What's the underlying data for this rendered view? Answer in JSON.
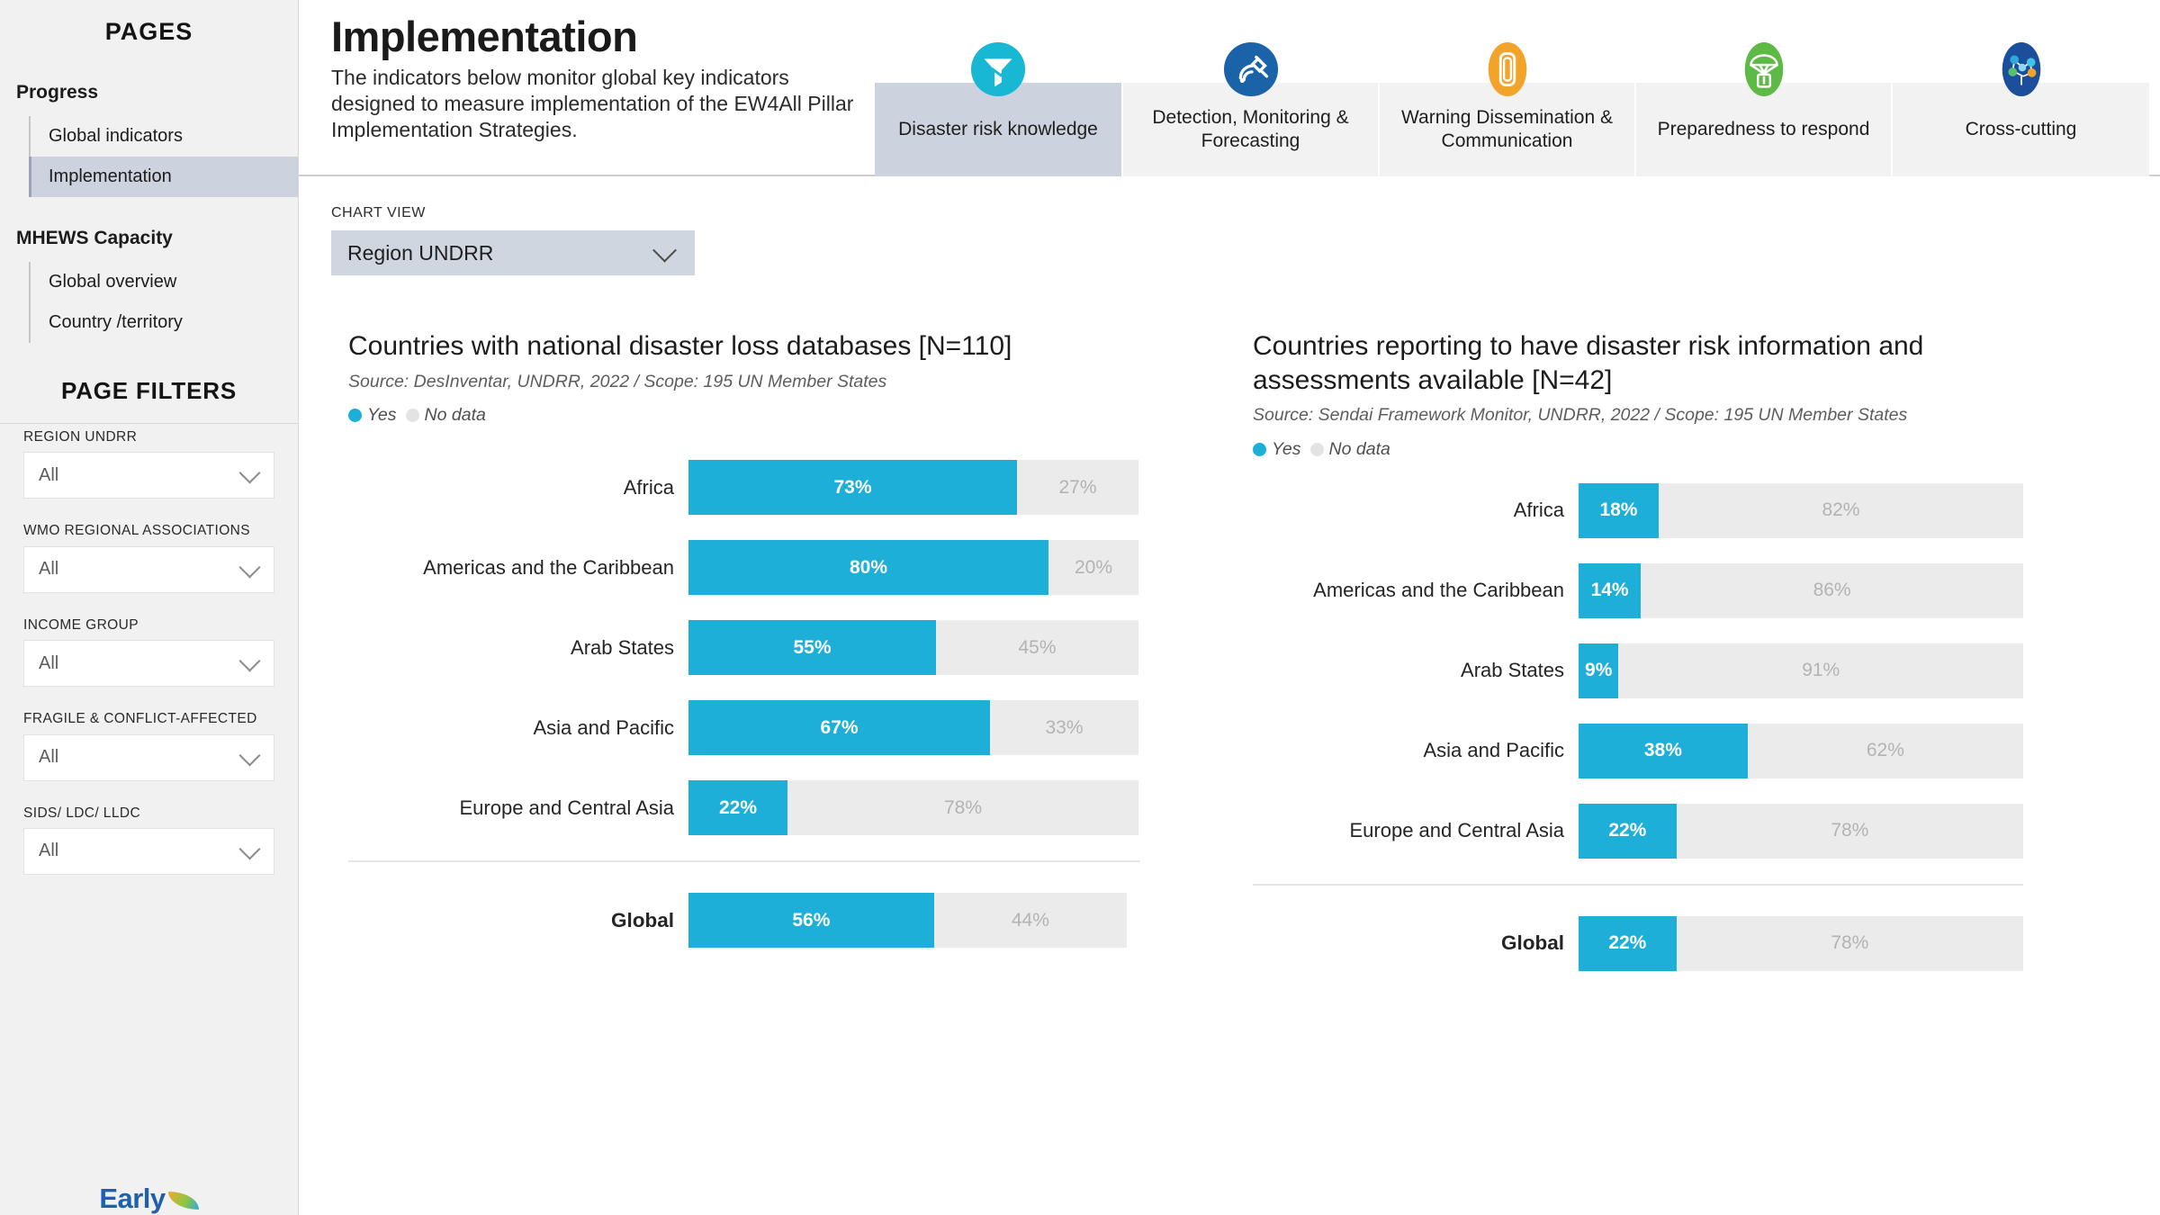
{
  "sidebar": {
    "pages_title": "PAGES",
    "groups": [
      {
        "title": "Progress",
        "items": [
          {
            "label": "Global indicators",
            "active": false
          },
          {
            "label": "Implementation",
            "active": true
          }
        ]
      },
      {
        "title": "MHEWS Capacity",
        "items": [
          {
            "label": "Global overview",
            "active": false
          },
          {
            "label": "Country /territory",
            "active": false
          }
        ]
      }
    ],
    "filters_title": "PAGE FILTERS",
    "filters": [
      {
        "label": "REGION UNDRR",
        "value": "All"
      },
      {
        "label": "WMO REGIONAL ASSOCIATIONS",
        "value": "All"
      },
      {
        "label": "INCOME GROUP",
        "value": "All"
      },
      {
        "label": "FRAGILE & CONFLICT-AFFECTED",
        "value": "All"
      },
      {
        "label": "SIDS/ LDC/ LLDC",
        "value": "All"
      }
    ],
    "logo_text": "Early"
  },
  "header": {
    "title": "Implementation",
    "description": "The indicators below monitor global key indicators designed to measure implementation of the EW4All Pillar Implementation Strategies."
  },
  "tabs": [
    {
      "label": "Disaster risk knowledge",
      "icon": "funnel-data-icon",
      "active": true,
      "color": "#18b7d4"
    },
    {
      "label": "Detection, Monitoring & Forecasting",
      "icon": "satellite-icon",
      "active": false,
      "color": "#1b63a8"
    },
    {
      "label": "Warning Dissemination & Communication",
      "icon": "megaphone-icon",
      "active": false,
      "color": "#f2a32a"
    },
    {
      "label": "Preparedness to respond",
      "icon": "parachute-icon",
      "active": false,
      "color": "#5eba46"
    },
    {
      "label": "Cross-cutting",
      "icon": "network-brain-icon",
      "active": false,
      "color": "#1b4f9c"
    }
  ],
  "chart_view": {
    "label": "CHART VIEW",
    "value": "Region UNDRR"
  },
  "colors": {
    "yes": "#1eafd8",
    "no_data": "#ebebeb",
    "active_tab": "#ccd3de",
    "sidebar_bg": "#f1f1f1"
  },
  "chart_data": [
    {
      "type": "bar",
      "orientation": "horizontal-stacked-100",
      "title": "Countries with national disaster loss databases [N=110]",
      "subtitle": "Source: DesInventar, UNDRR, 2022 / Scope: 195 UN Member States",
      "legend": [
        "Yes",
        "No data"
      ],
      "legend_position": "top-left",
      "xlabel": "",
      "ylabel": "",
      "xlim": [
        0,
        100
      ],
      "grid": false,
      "categories": [
        "Africa",
        "Americas and the Caribbean",
        "Arab States",
        "Asia and Pacific",
        "Europe and Central Asia"
      ],
      "series": [
        {
          "name": "Yes",
          "values": [
            73,
            80,
            55,
            67,
            22
          ]
        },
        {
          "name": "No data",
          "values": [
            27,
            20,
            45,
            33,
            78
          ]
        }
      ],
      "labels_yes": [
        "73%",
        "80%",
        "55%",
        "67%",
        "22%"
      ],
      "labels_nodata": [
        "27%",
        "20%",
        "45%",
        "33%",
        "78%"
      ],
      "total_row": {
        "label": "Global",
        "yes": 56,
        "no_data": 44,
        "label_yes": "56%",
        "label_nodata": "44%"
      }
    },
    {
      "type": "bar",
      "orientation": "horizontal-stacked-100",
      "title": "Countries reporting to have disaster risk information and assessments available [N=42]",
      "subtitle": "Source: Sendai Framework Monitor, UNDRR, 2022 / Scope: 195 UN Member States",
      "legend": [
        "Yes",
        "No data"
      ],
      "legend_position": "top-left",
      "xlabel": "",
      "ylabel": "",
      "xlim": [
        0,
        100
      ],
      "grid": false,
      "categories": [
        "Africa",
        "Americas and the Caribbean",
        "Arab States",
        "Asia and Pacific",
        "Europe and Central Asia"
      ],
      "series": [
        {
          "name": "Yes",
          "values": [
            18,
            14,
            9,
            38,
            22
          ]
        },
        {
          "name": "No data",
          "values": [
            82,
            86,
            91,
            62,
            78
          ]
        }
      ],
      "labels_yes": [
        "18%",
        "14%",
        "9%",
        "38%",
        "22%"
      ],
      "labels_nodata": [
        "82%",
        "86%",
        "91%",
        "62%",
        "78%"
      ],
      "total_row": {
        "label": "Global",
        "yes": 22,
        "no_data": 78,
        "label_yes": "22%",
        "label_nodata": "78%"
      }
    }
  ]
}
